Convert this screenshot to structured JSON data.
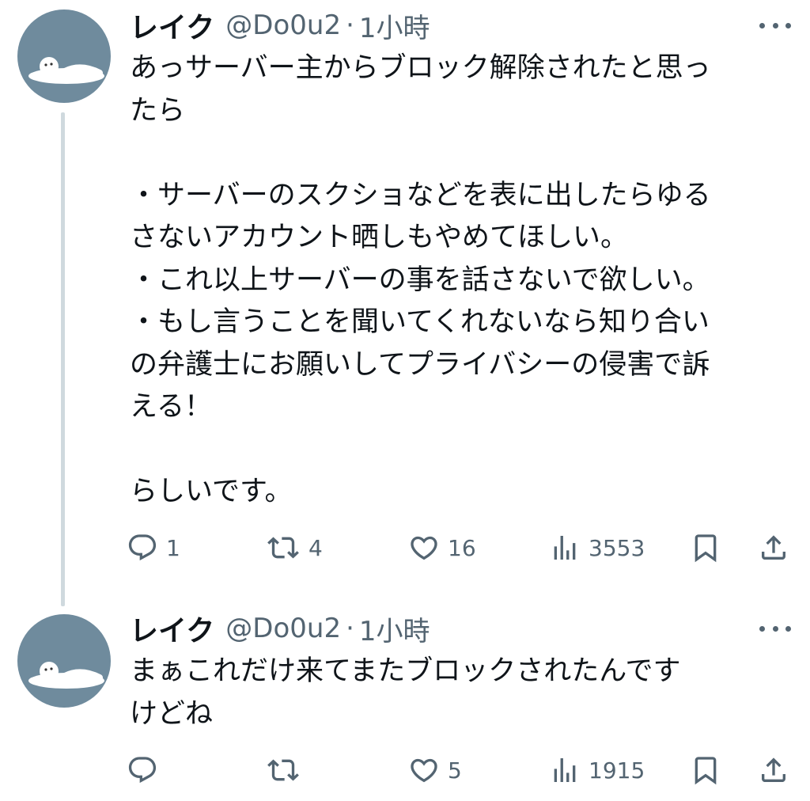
{
  "tweets": [
    {
      "author": {
        "name": "レイク",
        "handle": "@Do0u2"
      },
      "separator": "·",
      "time": "1小時",
      "lines": [
        "あっサーバー主からブロック解除されたと思っ",
        "たら",
        "",
        "・サーバーのスクショなどを表に出したらゆる",
        "さないアカウント晒しもやめてほしい。",
        "・これ以上サーバーの事を話さないで欲しい。",
        "・もし言うことを聞いてくれないなら知り合い",
        "の弁護士にお願いしてプライバシーの侵害で訴",
        "える！",
        "",
        "らしいです。"
      ],
      "stats": {
        "replies": "1",
        "retweets": "4",
        "likes": "16",
        "views": "3553"
      }
    },
    {
      "author": {
        "name": "レイク",
        "handle": "@Do0u2"
      },
      "separator": "·",
      "time": "1小時",
      "lines": [
        "まぁこれだけ来てまたブロックされたんです",
        "けどね"
      ],
      "stats": {
        "replies": "",
        "retweets": "",
        "likes": "5",
        "views": "1915"
      }
    }
  ],
  "icons": [
    "more-icon",
    "reply-icon",
    "retweet-icon",
    "like-icon",
    "views-icon",
    "bookmark-icon",
    "share-icon"
  ],
  "colors": {
    "text": "#0f1419",
    "secondary": "#536471",
    "avatar_bg": "#6f8b9d",
    "thread_line": "#cfd9de"
  }
}
